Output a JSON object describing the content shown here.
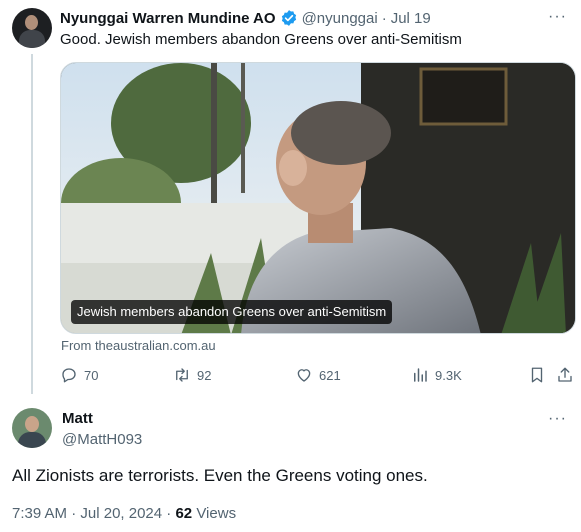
{
  "tweet": {
    "author_name": "Nyunggai Warren Mundine AO",
    "handle": "@nyunggai",
    "separator": "·",
    "date": "Jul 19",
    "text": "Good. Jewish members abandon Greens over anti-Semitism",
    "card": {
      "caption": "Jewish members abandon Greens over anti-Semitism",
      "source": "From theaustralian.com.au"
    },
    "actions": {
      "replies": "70",
      "retweets": "92",
      "likes": "621",
      "views": "9.3K"
    },
    "more": "···"
  },
  "reply": {
    "author_name": "Matt",
    "handle": "@MattH093",
    "text": "All Zionists are terrorists. Even the Greens voting ones.",
    "more": "···",
    "meta": {
      "time": "7:39 AM",
      "separator": "·",
      "date": "Jul 20, 2024",
      "separator2": "·",
      "views_count": "62",
      "views_label": "Views"
    }
  },
  "colors": {
    "text": "#0f1419",
    "secondary": "#536471",
    "verified": "#1d9bf0",
    "border": "#cfd9de"
  },
  "icons": [
    "verified-badge-icon",
    "reply-icon",
    "retweet-icon",
    "like-icon",
    "views-icon",
    "bookmark-icon",
    "share-icon",
    "more-icon"
  ]
}
